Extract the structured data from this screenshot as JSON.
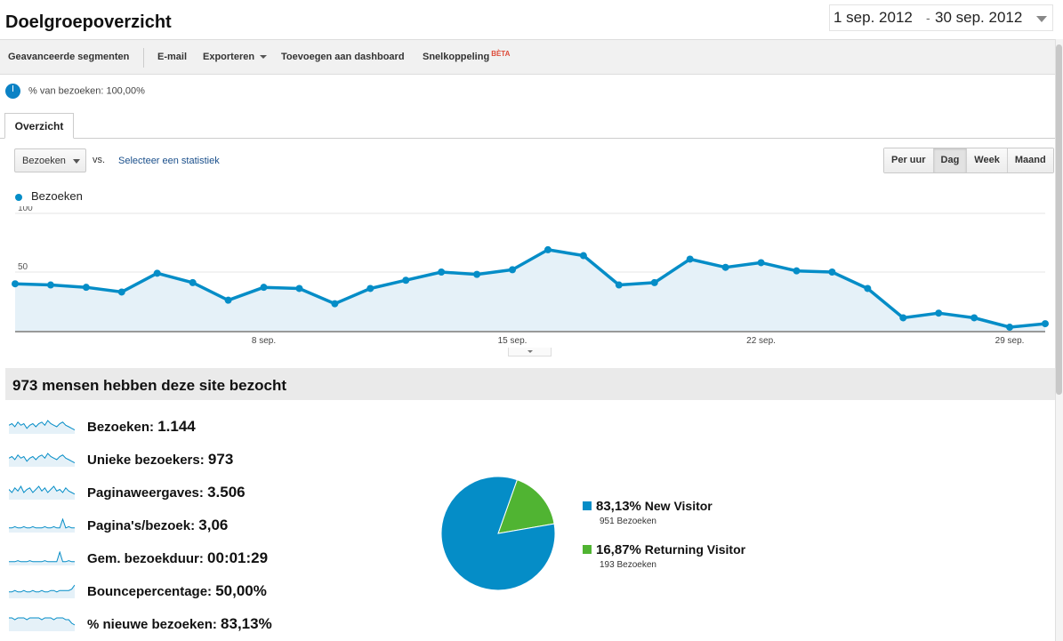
{
  "page": {
    "title": "Doelgroepoverzicht",
    "date_start": "1 sep. 2012",
    "date_sep": "-",
    "date_end": "30 sep. 2012"
  },
  "toolbar": {
    "advanced_segments": "Geavanceerde segmenten",
    "email": "E-mail",
    "export": "Exporteren",
    "add_dashboard": "Toevoegen aan dashboard",
    "shortcut": "Snelkoppeling",
    "beta": "BÈTA"
  },
  "segment": {
    "label": "% van bezoeken: 100,00%"
  },
  "tabs": {
    "overview": "Overzicht"
  },
  "controls": {
    "metric": "Bezoeken",
    "vs": "vs.",
    "select_stat": "Selecteer een statistiek",
    "periods": [
      "Per uur",
      "Dag",
      "Week",
      "Maand"
    ],
    "active_period": "Dag"
  },
  "colors": {
    "series": "#058dc7",
    "fill": "#e5f1f8",
    "new": "#058dc7",
    "returning": "#50b432"
  },
  "chart_data": {
    "type": "area",
    "series": [
      {
        "name": "Bezoeken",
        "values": [
          40,
          39,
          37,
          33,
          49,
          41,
          26,
          37,
          36,
          23,
          36,
          43,
          50,
          48,
          52,
          69,
          64,
          39,
          41,
          61,
          54,
          58,
          51,
          50,
          36,
          11,
          15,
          11,
          3,
          6
        ]
      }
    ],
    "x": [
      "1 sep.",
      "2 sep.",
      "3 sep.",
      "4 sep.",
      "5 sep.",
      "6 sep.",
      "7 sep.",
      "8 sep.",
      "9 sep.",
      "10 sep.",
      "11 sep.",
      "12 sep.",
      "13 sep.",
      "14 sep.",
      "15 sep.",
      "16 sep.",
      "17 sep.",
      "18 sep.",
      "19 sep.",
      "20 sep.",
      "21 sep.",
      "22 sep.",
      "23 sep.",
      "24 sep.",
      "25 sep.",
      "26 sep.",
      "27 sep.",
      "28 sep.",
      "29 sep.",
      "30 sep."
    ],
    "x_tick_labels": [
      "8 sep.",
      "15 sep.",
      "22 sep.",
      "29 sep."
    ],
    "y_tick_labels": [
      "100",
      "50"
    ],
    "ylim": [
      0,
      100
    ],
    "legend": "top-left",
    "grid": true
  },
  "summary": {
    "headline": "973 mensen hebben deze site bezocht",
    "stats": [
      {
        "label": "Bezoeken:",
        "value": "1.144"
      },
      {
        "label": "Unieke bezoekers:",
        "value": "973"
      },
      {
        "label": "Paginaweergaves:",
        "value": "3.506"
      },
      {
        "label": "Pagina's/bezoek:",
        "value": "3,06"
      },
      {
        "label": "Gem. bezoekduur:",
        "value": "00:01:29"
      },
      {
        "label": "Bouncepercentage:",
        "value": "50,00%"
      },
      {
        "label": "% nieuwe bezoeken:",
        "value": "83,13%"
      }
    ]
  },
  "visitor_pie": {
    "type": "pie",
    "slices": [
      {
        "pct_text": "83,13%",
        "label": "New Visitor",
        "sub": "951 Bezoeken",
        "value": 83.13
      },
      {
        "pct_text": "16,87%",
        "label": "Returning Visitor",
        "sub": "193 Bezoeken",
        "value": 16.87
      }
    ]
  }
}
